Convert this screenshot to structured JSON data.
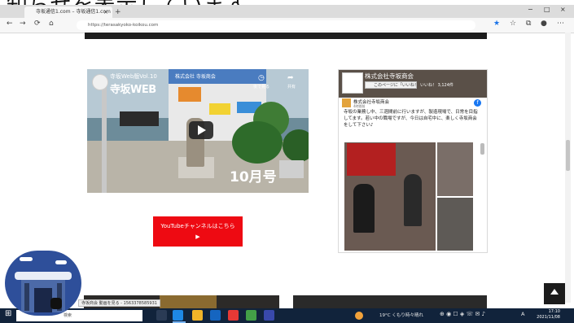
{
  "caption": "知らせを表示しています。",
  "browser": {
    "tab_title": "寺坂通信1.com – 寺坂通信1.com",
    "tab_close": "×",
    "tab_add": "+",
    "url": "https://terasakyoko-koikou.com",
    "window_controls": [
      "−",
      "□",
      "×"
    ]
  },
  "video": {
    "channel_title": "寺坂Web版Vol.10",
    "big_title": "寺坂WEB",
    "watch_later": "後で見る",
    "share": "共有",
    "logo_text": "株式会社 寺坂商会",
    "month": "10月号"
  },
  "youtube_button": {
    "label": "YouTubeチャンネルはこちら",
    "arrow": "▶"
  },
  "facebook": {
    "page_name": "株式会社寺坂商会",
    "like_label": "このページに「いいね！」",
    "likes_count": "いいね！ 3,124件",
    "post_name": "株式会社寺坂商会",
    "post_date": "4時間前",
    "post_text": "寺坂の業務し中、三週間前に行いますが、製造現場で、日常を目指してます。若い中の職場ですが、今日は自宅中に、楽しく寺坂商会をして下さい♪"
  },
  "bottom": {
    "link_tooltip": "寺坂商会 動画を見る - 1563378585931"
  },
  "taskbar": {
    "search_placeholder": "検索",
    "weather": "19°C くもり時々晴れ",
    "clock_time": "17:10",
    "clock_date": "2021/11/08",
    "ime": "A"
  },
  "colors": {
    "youtube_red": "#ee0a12",
    "facebook_blue": "#1877f2",
    "taskbar": "#11233b"
  }
}
